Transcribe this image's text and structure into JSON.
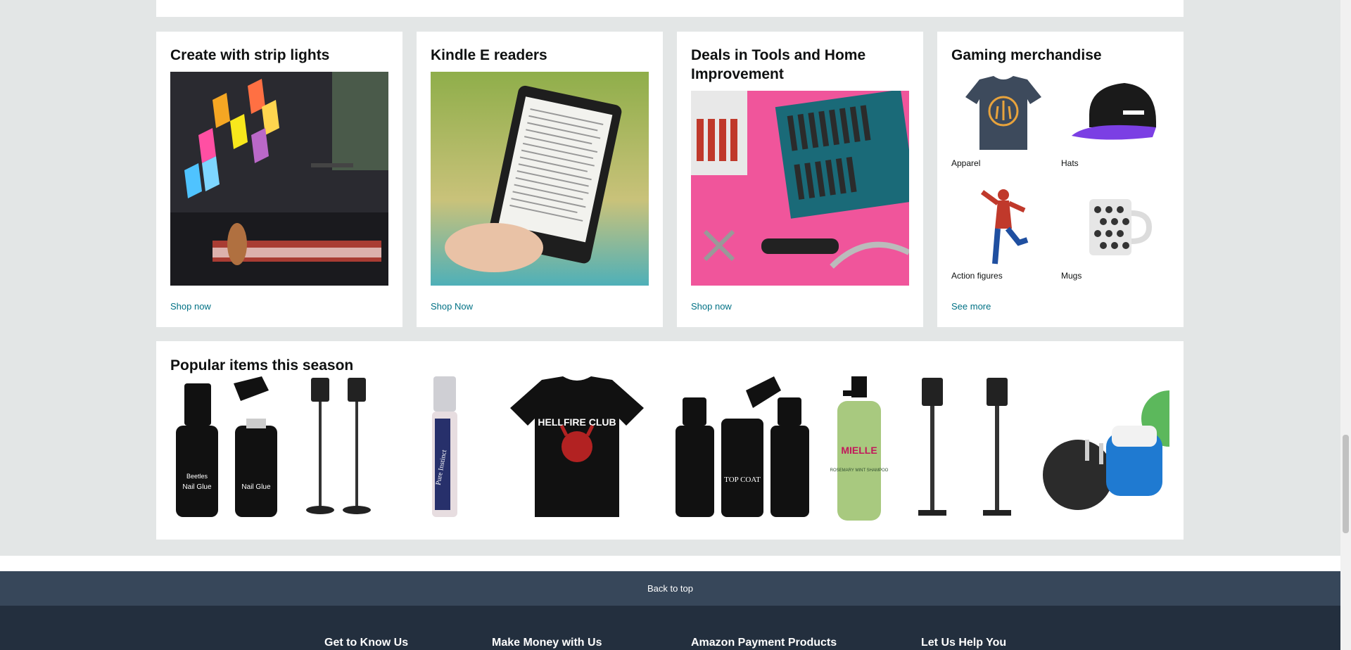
{
  "cards": [
    {
      "title": "Create with strip lights",
      "link": "Shop now"
    },
    {
      "title": "Kindle E readers",
      "link": "Shop Now"
    },
    {
      "title": "Deals in Tools and Home Improvement",
      "link": "Shop now"
    },
    {
      "title": "Gaming merchandise",
      "link": "See more",
      "items": [
        {
          "label": "Apparel"
        },
        {
          "label": "Hats"
        },
        {
          "label": "Action figures"
        },
        {
          "label": "Mugs"
        }
      ]
    }
  ],
  "popular": {
    "title": "Popular items this season",
    "items": [
      {
        "name": "nail-glue",
        "brand": "Beetles",
        "text": "Nail Glue"
      },
      {
        "name": "speaker-stands"
      },
      {
        "name": "perfume-roller",
        "text": "Pure Instinct"
      },
      {
        "name": "hellfire-tshirt",
        "text": "HELLFIRE CLUB"
      },
      {
        "name": "gel-polish-set",
        "text": "TOP COAT"
      },
      {
        "name": "shampoo",
        "brand": "MIELLE",
        "text": "ROSEMARY MINT SHAMPOO"
      },
      {
        "name": "speaker-stands-2"
      },
      {
        "name": "travel-adapter"
      }
    ]
  },
  "back_to_top": "Back to top",
  "footer": {
    "columns": [
      "Get to Know Us",
      "Make Money with Us",
      "Amazon Payment Products",
      "Let Us Help You"
    ]
  },
  "colors": {
    "background": "#e3e6e6",
    "link": "#007185",
    "back_to_top": "#37475a",
    "footer": "#232f3e"
  }
}
